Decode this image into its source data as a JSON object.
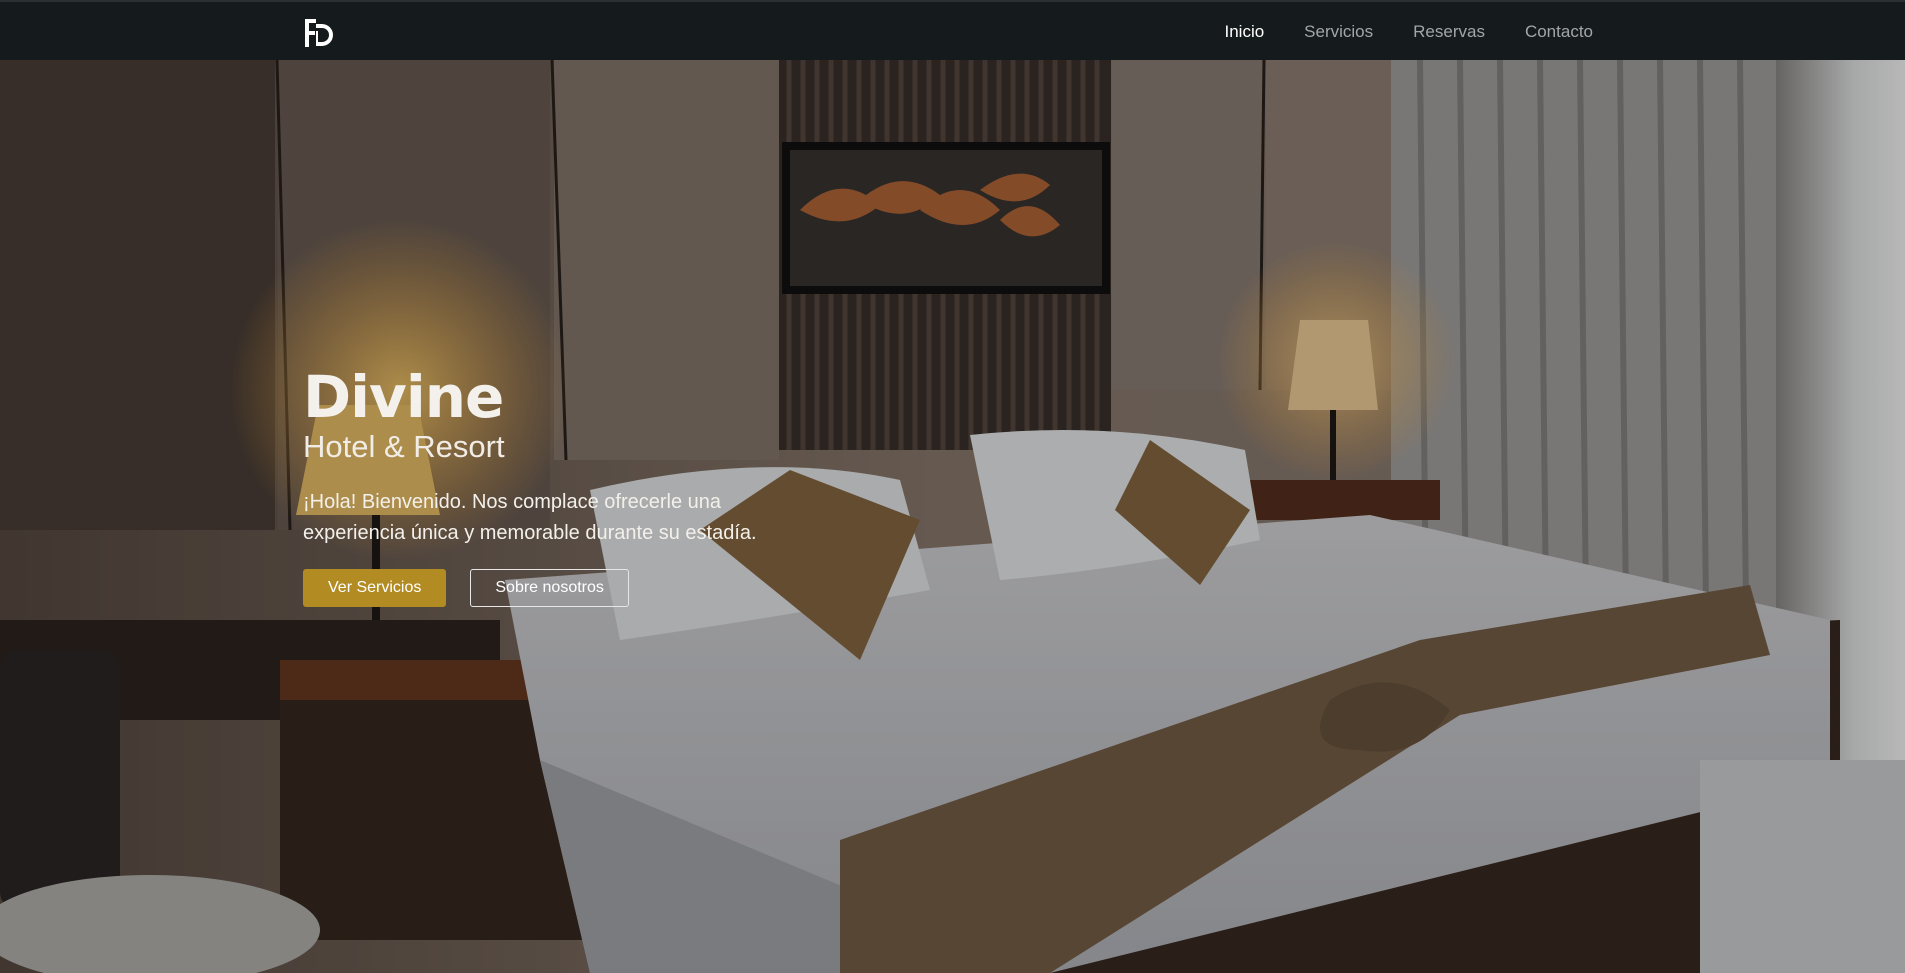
{
  "nav": {
    "logo_alt": "DH",
    "links": [
      {
        "label": "Inicio",
        "active": true
      },
      {
        "label": "Servicios",
        "active": false
      },
      {
        "label": "Reservas",
        "active": false
      },
      {
        "label": "Contacto",
        "active": false
      }
    ]
  },
  "hero": {
    "title": "Divine",
    "subtitle": "Hotel & Resort",
    "text": "¡Hola! Bienvenido. Nos complace ofrecerle una experiencia única y memorable durante su estadía.",
    "primary_button": "Ver Servicios",
    "secondary_button": "Sobre nosotros",
    "background_image": "hotel bedroom with lamps and bed"
  },
  "colors": {
    "navbar": "#151b1c",
    "accent": "#b28b22",
    "nav_inactive": "#a2a6a7",
    "nav_active": "#ffffff"
  }
}
